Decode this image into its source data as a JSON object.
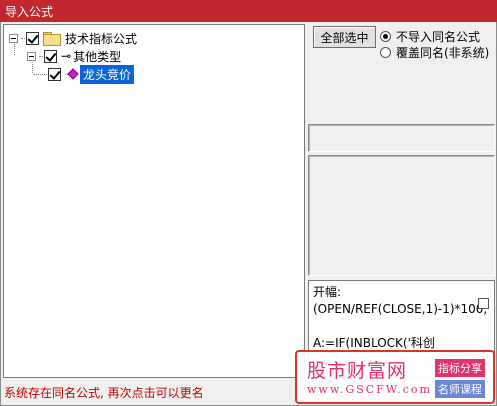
{
  "window": {
    "title": "导入公式"
  },
  "tree": {
    "root": {
      "label": "技术指标公式"
    },
    "child": {
      "label": "其他类型"
    },
    "leaf": {
      "label": "龙头竞价"
    }
  },
  "options": {
    "select_all_label": "全部选中",
    "radio_skip_label": "不导入同名公式",
    "radio_overwrite_label": "覆盖同名(非系统)",
    "selected": "不导入同名公式"
  },
  "formula": {
    "text": "开幅:(OPEN/REF(CLOSE,1)-1)*100;\n\nA:=IF(INBLOCK('科创"
  },
  "status": {
    "message": "系统存在同名公式, 再次点击可以更名"
  },
  "watermark": {
    "title": "股市财富网",
    "url": "www.GSCFW.com",
    "tag1": "指标分享",
    "tag2": "名师课程"
  },
  "colors": {
    "titlebar": "#c0282d",
    "selection": "#0a64d8",
    "status_text": "#c00000"
  }
}
